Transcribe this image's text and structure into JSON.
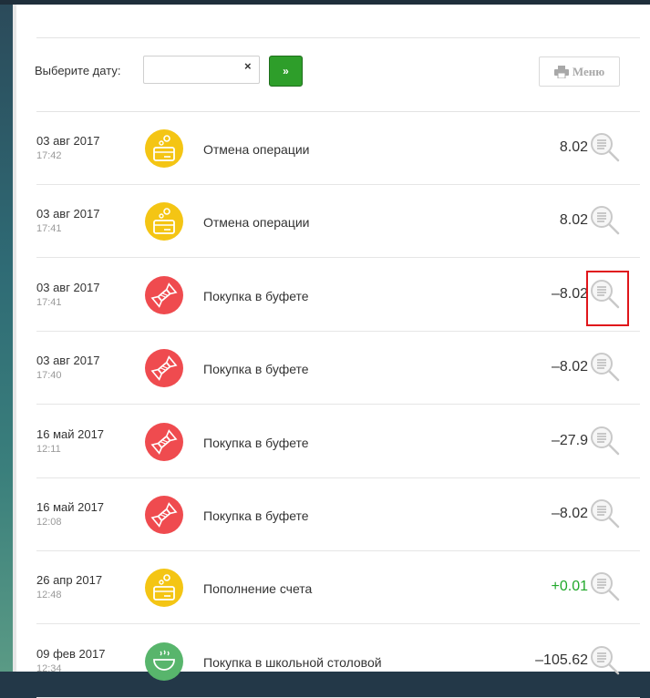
{
  "filter": {
    "label": "Выберите дату:",
    "date_value": "",
    "date_placeholder": "",
    "clear": "×",
    "go": "»"
  },
  "menu_button": {
    "label": "Меню"
  },
  "transactions": [
    {
      "date": "03 авг 2017",
      "time": "17:42",
      "description": "Отмена операции",
      "amount": "8.02",
      "icon": "wallet-icon",
      "color": "#f4c514"
    },
    {
      "date": "03 авг 2017",
      "time": "17:41",
      "description": "Отмена операции",
      "amount": "8.02",
      "icon": "wallet-icon",
      "color": "#f4c514"
    },
    {
      "date": "03 авг 2017",
      "time": "17:41",
      "description": "Покупка в буфете",
      "amount": "–8.02",
      "icon": "candy-icon",
      "color": "#ef4b4f"
    },
    {
      "date": "03 авг 2017",
      "time": "17:40",
      "description": "Покупка в буфете",
      "amount": "–8.02",
      "icon": "candy-icon",
      "color": "#ef4b4f"
    },
    {
      "date": "16 май 2017",
      "time": "12:11",
      "description": "Покупка в буфете",
      "amount": "–27.9",
      "icon": "candy-icon",
      "color": "#ef4b4f"
    },
    {
      "date": "16 май 2017",
      "time": "12:08",
      "description": "Покупка в буфете",
      "amount": "–8.02",
      "icon": "candy-icon",
      "color": "#ef4b4f"
    },
    {
      "date": "26 апр 2017",
      "time": "12:48",
      "description": "Пополнение счета",
      "amount": "+0.01",
      "icon": "wallet-icon",
      "color": "#f4c514",
      "amount_color": "#21a82b"
    },
    {
      "date": "09 фев 2017",
      "time": "12:34",
      "description": "Покупка в школьной столовой",
      "amount": "–105.62",
      "icon": "food-bowl-icon",
      "color": "#58b56c"
    }
  ],
  "colors": {
    "accent_green": "#2e9e2a",
    "highlight_red": "#e0161b",
    "positive": "#21a82b"
  }
}
